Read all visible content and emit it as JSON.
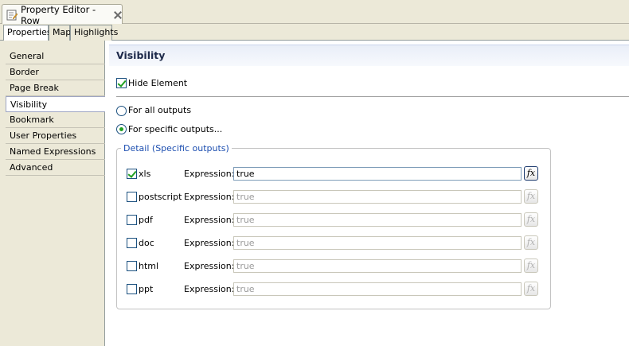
{
  "editor": {
    "title": "Property Editor - Row",
    "tabs": [
      {
        "label": "Properties",
        "active": true
      },
      {
        "label": "Map",
        "active": false
      },
      {
        "label": "Highlights",
        "active": false
      }
    ]
  },
  "sidebar": {
    "items": [
      {
        "label": "General"
      },
      {
        "label": "Border"
      },
      {
        "label": "Page Break"
      },
      {
        "label": "Visibility",
        "selected": true
      },
      {
        "label": "Bookmark"
      },
      {
        "label": "User Properties"
      },
      {
        "label": "Named Expressions"
      },
      {
        "label": "Advanced"
      }
    ]
  },
  "visibility": {
    "header": "Visibility",
    "hide_element": {
      "label": "Hide Element",
      "checked": true
    },
    "all_outputs": {
      "label": "For all outputs",
      "selected": false
    },
    "specific_outputs": {
      "label": "For specific outputs...",
      "selected": true
    },
    "group_label": "Detail (Specific outputs)",
    "expression_label": "Expression:",
    "fx_label": "fx",
    "outputs": [
      {
        "name": "xls",
        "checked": true,
        "expression": "true",
        "enabled": true
      },
      {
        "name": "postscript",
        "checked": false,
        "expression": "true",
        "enabled": false
      },
      {
        "name": "pdf",
        "checked": false,
        "expression": "true",
        "enabled": false
      },
      {
        "name": "doc",
        "checked": false,
        "expression": "true",
        "enabled": false
      },
      {
        "name": "html",
        "checked": false,
        "expression": "true",
        "enabled": false
      },
      {
        "name": "ppt",
        "checked": false,
        "expression": "true",
        "enabled": false
      }
    ]
  },
  "colors": {
    "accent_check": "#21a121",
    "group_legend": "#1c4eb0",
    "panel_bg": "#ece9d8"
  }
}
